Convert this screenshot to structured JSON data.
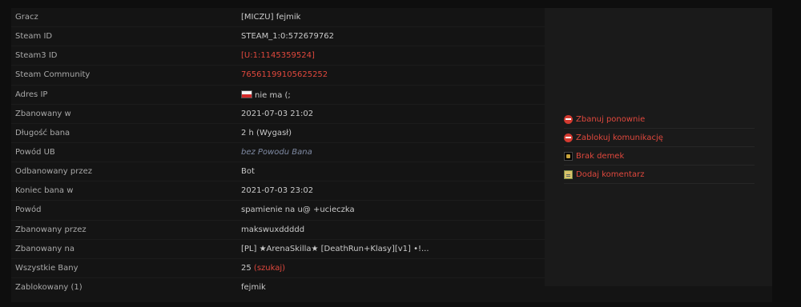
{
  "details": [
    {
      "label": "Gracz",
      "value": "[MICZU] fejmik",
      "style": "normal"
    },
    {
      "label": "Steam ID",
      "value": "STEAM_1:0:572679762",
      "style": "normal"
    },
    {
      "label": "Steam3 ID",
      "value": "[U:1:1145359524]",
      "style": "red"
    },
    {
      "label": "Steam Community",
      "value": "76561199105625252",
      "style": "red"
    },
    {
      "label": "Adres IP",
      "value": "nie ma (;",
      "style": "flag",
      "icon": "poland-flag-icon"
    },
    {
      "label": "Zbanowany w",
      "value": "2021-07-03 21:02",
      "style": "normal"
    },
    {
      "label": "Długość bana",
      "value": "2 h (Wygasł)",
      "style": "normal"
    },
    {
      "label": "Powód UB",
      "value": "bez Powodu Bana",
      "style": "italic"
    },
    {
      "label": "Odbanowany przez",
      "value": "Bot",
      "style": "normal"
    },
    {
      "label": "Koniec bana w",
      "value": "2021-07-03 23:02",
      "style": "normal"
    },
    {
      "label": "Powód",
      "value": "spamienie na u@ +ucieczka",
      "style": "normal"
    },
    {
      "label": "Zbanowany przez",
      "value": "makswuxddddd",
      "style": "normal"
    },
    {
      "label": "Zbanowany na",
      "value": "[PL] ★ArenaSkilla★ [DeathRun+Klasy][v1] •!...",
      "style": "normal"
    },
    {
      "label": "Wszystkie Bany",
      "value": "25",
      "link": "(szukaj)",
      "style": "count"
    },
    {
      "label": "Zablokowany (1)",
      "value": "fejmik",
      "style": "normal"
    }
  ],
  "actions": [
    {
      "label": "Zbanuj ponownie",
      "icon": "no-entry-icon"
    },
    {
      "label": "Zablokuj komunikację",
      "icon": "no-entry-icon"
    },
    {
      "label": "Brak demek",
      "icon": "demo-icon"
    },
    {
      "label": "Dodaj komentarz",
      "icon": "note-icon"
    }
  ],
  "colors": {
    "accent": "#e0483d",
    "background": "#0e0e0e",
    "panel": "#141414",
    "sidebar": "#1a1a1a"
  }
}
